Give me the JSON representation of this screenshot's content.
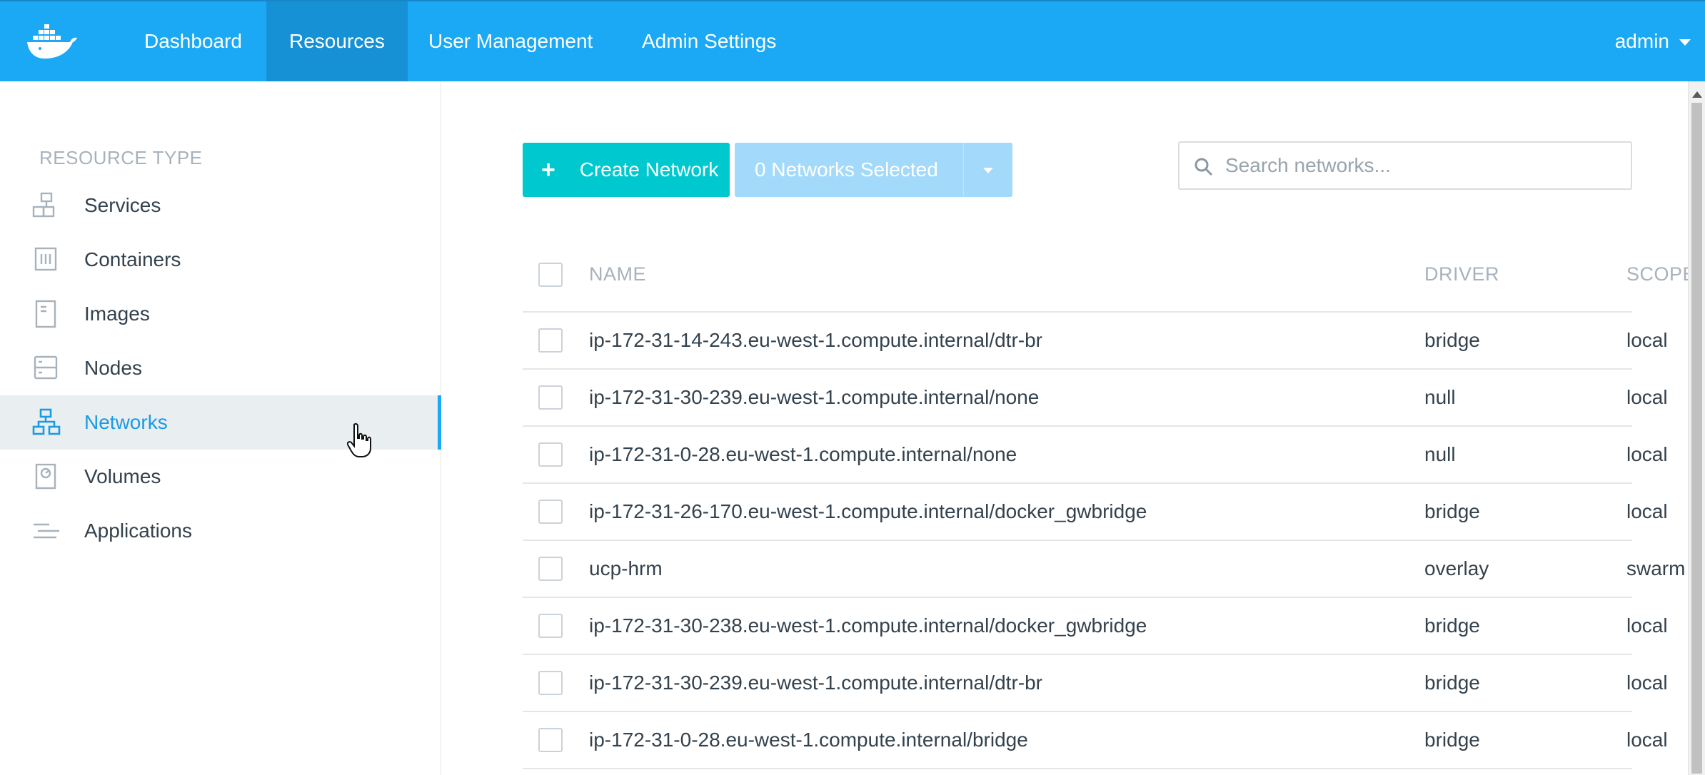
{
  "header": {
    "nav": [
      "Dashboard",
      "Resources",
      "User Management",
      "Admin Settings"
    ],
    "active_nav": "Resources",
    "user": "admin",
    "brand_color": "#1ba8f4",
    "logo_icon": "docker-whale-icon"
  },
  "sidebar": {
    "heading": "RESOURCE TYPE",
    "items": [
      {
        "label": "Services",
        "icon": "services-icon"
      },
      {
        "label": "Containers",
        "icon": "containers-icon"
      },
      {
        "label": "Images",
        "icon": "images-icon"
      },
      {
        "label": "Nodes",
        "icon": "nodes-icon"
      },
      {
        "label": "Networks",
        "icon": "networks-icon"
      },
      {
        "label": "Volumes",
        "icon": "volumes-icon"
      },
      {
        "label": "Applications",
        "icon": "applications-icon"
      }
    ],
    "active": "Networks"
  },
  "toolbar": {
    "create_label": "Create Network",
    "selected_label": "0 Networks Selected",
    "search_placeholder": "Search networks..."
  },
  "table": {
    "columns": [
      "NAME",
      "DRIVER",
      "SCOPE"
    ],
    "rows": [
      {
        "name": "ip-172-31-14-243.eu-west-1.compute.internal/dtr-br",
        "driver": "bridge",
        "scope": "local"
      },
      {
        "name": "ip-172-31-30-239.eu-west-1.compute.internal/none",
        "driver": "null",
        "scope": "local"
      },
      {
        "name": "ip-172-31-0-28.eu-west-1.compute.internal/none",
        "driver": "null",
        "scope": "local"
      },
      {
        "name": "ip-172-31-26-170.eu-west-1.compute.internal/docker_gwbridge",
        "driver": "bridge",
        "scope": "local"
      },
      {
        "name": "ucp-hrm",
        "driver": "overlay",
        "scope": "swarm"
      },
      {
        "name": "ip-172-31-30-238.eu-west-1.compute.internal/docker_gwbridge",
        "driver": "bridge",
        "scope": "local"
      },
      {
        "name": "ip-172-31-30-239.eu-west-1.compute.internal/dtr-br",
        "driver": "bridge",
        "scope": "local"
      },
      {
        "name": "ip-172-31-0-28.eu-west-1.compute.internal/bridge",
        "driver": "bridge",
        "scope": "local"
      }
    ]
  }
}
